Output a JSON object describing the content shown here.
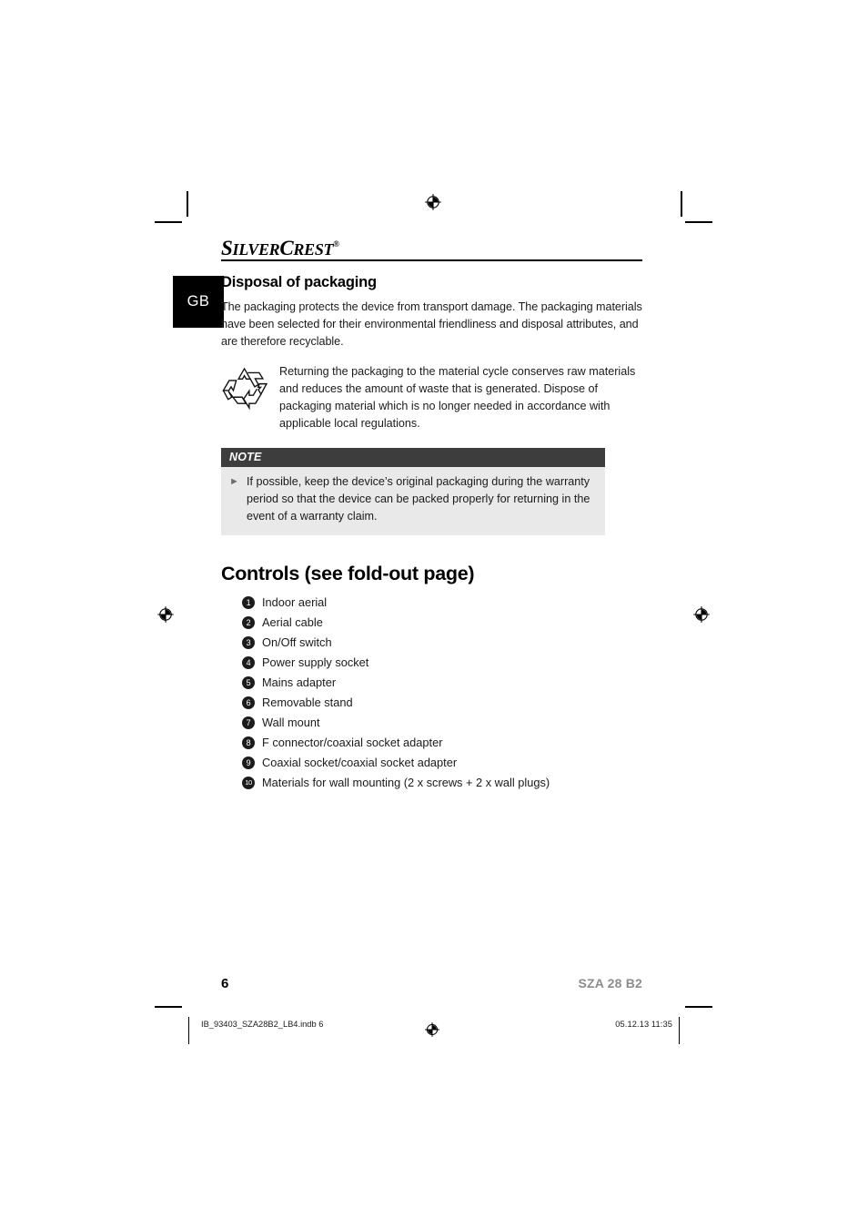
{
  "brand": {
    "name_part1": "S",
    "name_part2": "ILVER",
    "name_part3": "C",
    "name_part4": "REST",
    "registered_mark": "®"
  },
  "language_tab": {
    "code": "GB"
  },
  "disposal_section": {
    "heading": "Disposal of packaging",
    "paragraph": "The packaging protects the device from transport damage. The packaging materials have been selected for their environmental friendliness and disposal attributes, and are therefore recyclable.",
    "recycle_icon_name": "recycling-mobius-loop-icon",
    "recycle_text": "Returning the packaging to the material cycle conserves raw materials and reduces the amount of waste that is generated. Dispose of packaging material which is no longer needed in accordance with applicable local regulations."
  },
  "note_box": {
    "header": "NOTE",
    "bullet_glyph": "►",
    "text": "If possible, keep the device’s original packaging during the warranty period so that the device can be packed properly for returning in the event of a warranty claim."
  },
  "controls_section": {
    "heading": "Controls (see fold-out page)",
    "items": [
      {
        "number": "1",
        "label": "Indoor aerial"
      },
      {
        "number": "2",
        "label": "Aerial cable"
      },
      {
        "number": "3",
        "label": "On/Off switch"
      },
      {
        "number": "4",
        "label": "Power supply socket"
      },
      {
        "number": "5",
        "label": "Mains adapter"
      },
      {
        "number": "6",
        "label": "Removable stand"
      },
      {
        "number": "7",
        "label": "Wall mount"
      },
      {
        "number": "8",
        "label": "F connector/coaxial socket adapter"
      },
      {
        "number": "9",
        "label": "Coaxial socket/coaxial socket adapter"
      },
      {
        "number": "10",
        "label": "Materials for wall mounting (2 x screws + 2 x wall plugs)"
      }
    ]
  },
  "footer": {
    "page_number": "6",
    "model": "SZA 28 B2"
  },
  "imprint": {
    "file": "IB_93403_SZA28B2_LB4.indb   6",
    "timestamp": "05.12.13   11:35"
  },
  "colors": {
    "note_header_bg": "#3d3d3d",
    "note_body_bg": "#e9e9e9",
    "lang_tab_bg": "#000000",
    "number_circle_bg": "#1c1c1c",
    "model_gray": "#8c8c8c"
  }
}
